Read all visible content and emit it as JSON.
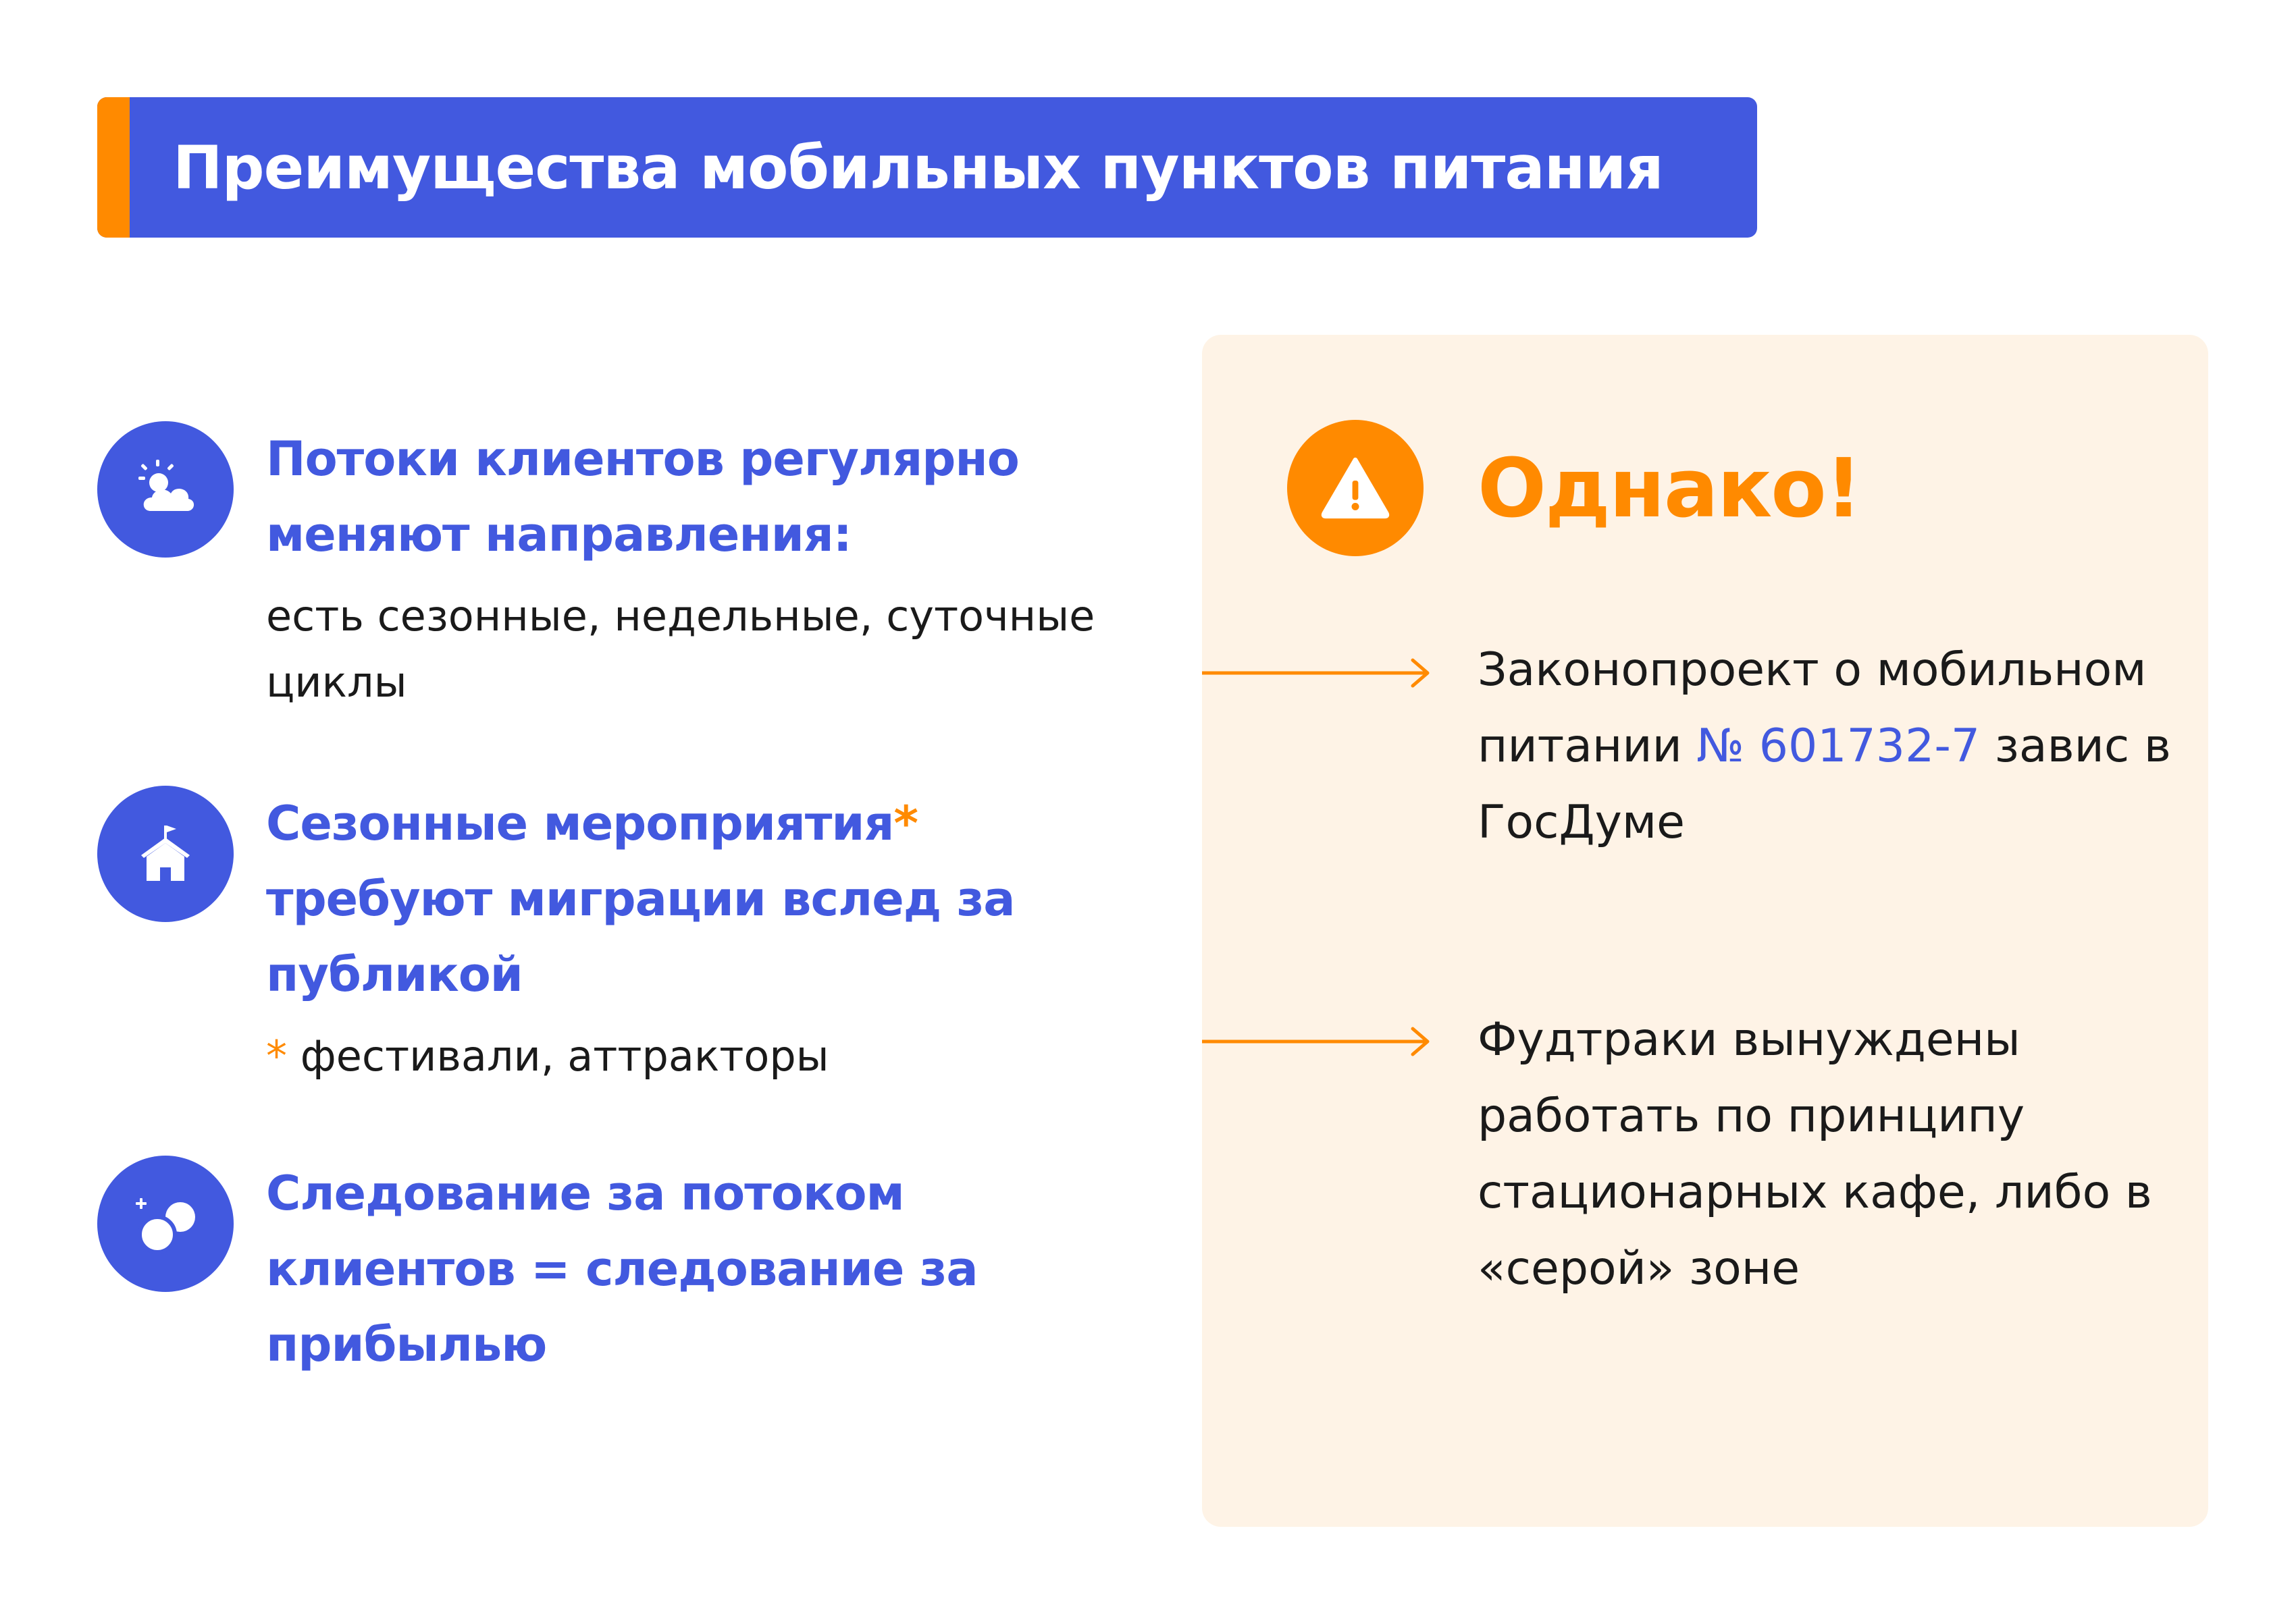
{
  "header": {
    "title": "Преимущества мобильных пунктов питания"
  },
  "benefits": [
    {
      "icon": "weather-icon",
      "title": "Потоки клиентов регулярно меняют направления:",
      "description": "есть сезонные, недельные, суточные циклы"
    },
    {
      "icon": "event-tent-icon",
      "title": "Сезонные мероприятия",
      "title_marker": "*",
      "title_rest": "требуют миграции вслед за публикой",
      "footnote_marker": "*",
      "footnote": "фестивали, аттракторы"
    },
    {
      "icon": "bubbles-icon",
      "title": "Следование за потоком клиентов = следование за прибылью"
    }
  ],
  "note": {
    "icon": "warning-icon",
    "title": "Однако!",
    "points": [
      {
        "text_before": "Законопроект о мобильном питании",
        "law_number": "№ 601732-7",
        "text_after": "завис в ГосДуме"
      },
      {
        "text": "Фудтраки вынуждены работать по принципу стационарных кафе, либо в «серой» зоне"
      }
    ]
  },
  "colors": {
    "primary": "#4259df",
    "accent": "#ff8a00",
    "note_bg": "#fef3e6",
    "text": "#1a1a1a"
  }
}
